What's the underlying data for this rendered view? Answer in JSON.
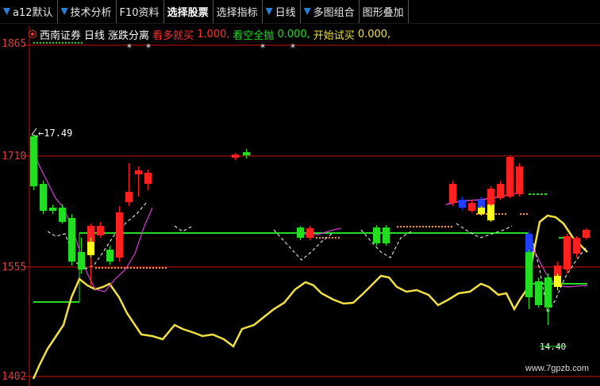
{
  "toolbar": {
    "items": [
      {
        "label": "a12默认",
        "arrow": true,
        "active": false
      },
      {
        "label": "技术分析",
        "arrow": true,
        "active": false
      },
      {
        "label": "F10资料",
        "arrow": false,
        "active": false
      },
      {
        "label": "选择股票",
        "arrow": false,
        "active": true
      },
      {
        "label": "选择指标",
        "arrow": false,
        "active": false
      },
      {
        "label": "日线",
        "arrow": true,
        "active": false
      },
      {
        "label": "多图组合",
        "arrow": true,
        "active": false
      },
      {
        "label": "图形叠加",
        "arrow": false,
        "active": false
      }
    ]
  },
  "infobar": {
    "stock_name": "西南证券",
    "period": "日线",
    "indicator": "涨跌分离",
    "bull_label": "看多就买",
    "bull_value": "1.000,",
    "bear_label": "看空全抛",
    "bear_value": "0.000,",
    "start_label": "开始试买",
    "start_value": "0.000,",
    "markers": [
      "*",
      "*",
      "*",
      "*"
    ]
  },
  "y_axis": {
    "labels": [
      "1865",
      "1710",
      "1555",
      "1402"
    ]
  },
  "annotations": {
    "high_price": "17.49",
    "low_price": "14.40"
  },
  "watermark": "www.7gpzb.com",
  "colors": {
    "up": "#ff2020",
    "down": "#22dd22",
    "yellow_line": "#f0e040",
    "magenta_line": "#d040d0",
    "axis": "#cc1010",
    "green_line": "#22dd22",
    "blue_candle": "#2040ff",
    "yellow_candle": "#ffff20"
  },
  "chart_data": {
    "type": "candlestick",
    "ylim": [
      1402,
      1865
    ],
    "yticks": [
      1865,
      1710,
      1555,
      1402
    ],
    "candles": [
      {
        "o": 1730,
        "h": 1735,
        "l": 1660,
        "c": 1672,
        "color": "down"
      },
      {
        "o": 1672,
        "h": 1680,
        "l": 1630,
        "c": 1640,
        "color": "down"
      },
      {
        "o": 1640,
        "h": 1648,
        "l": 1630,
        "c": 1636,
        "color": "down"
      },
      {
        "o": 1638,
        "h": 1645,
        "l": 1620,
        "c": 1625,
        "color": "down"
      },
      {
        "o": 1625,
        "h": 1630,
        "l": 1540,
        "c": 1552,
        "color": "down"
      },
      {
        "o": 1560,
        "h": 1602,
        "l": 1552,
        "c": 1598,
        "color": "yellow"
      },
      {
        "o": 1580,
        "h": 1605,
        "l": 1570,
        "c": 1600,
        "color": "up"
      },
      {
        "o": 1585,
        "h": 1600,
        "l": 1575,
        "c": 1597,
        "color": "up"
      },
      {
        "o": 1555,
        "h": 1630,
        "l": 1545,
        "c": 1620,
        "color": "up"
      },
      {
        "o": 1640,
        "h": 1690,
        "l": 1632,
        "c": 1650,
        "color": "up"
      },
      {
        "o": 1660,
        "h": 1700,
        "l": 1650,
        "c": 1695,
        "color": "up"
      },
      {
        "o": 1695,
        "h": 1702,
        "l": 1690,
        "c": 1698,
        "color": "up"
      },
      {
        "o": 1670,
        "h": 1695,
        "l": 1665,
        "c": 1690,
        "color": "up"
      }
    ]
  }
}
